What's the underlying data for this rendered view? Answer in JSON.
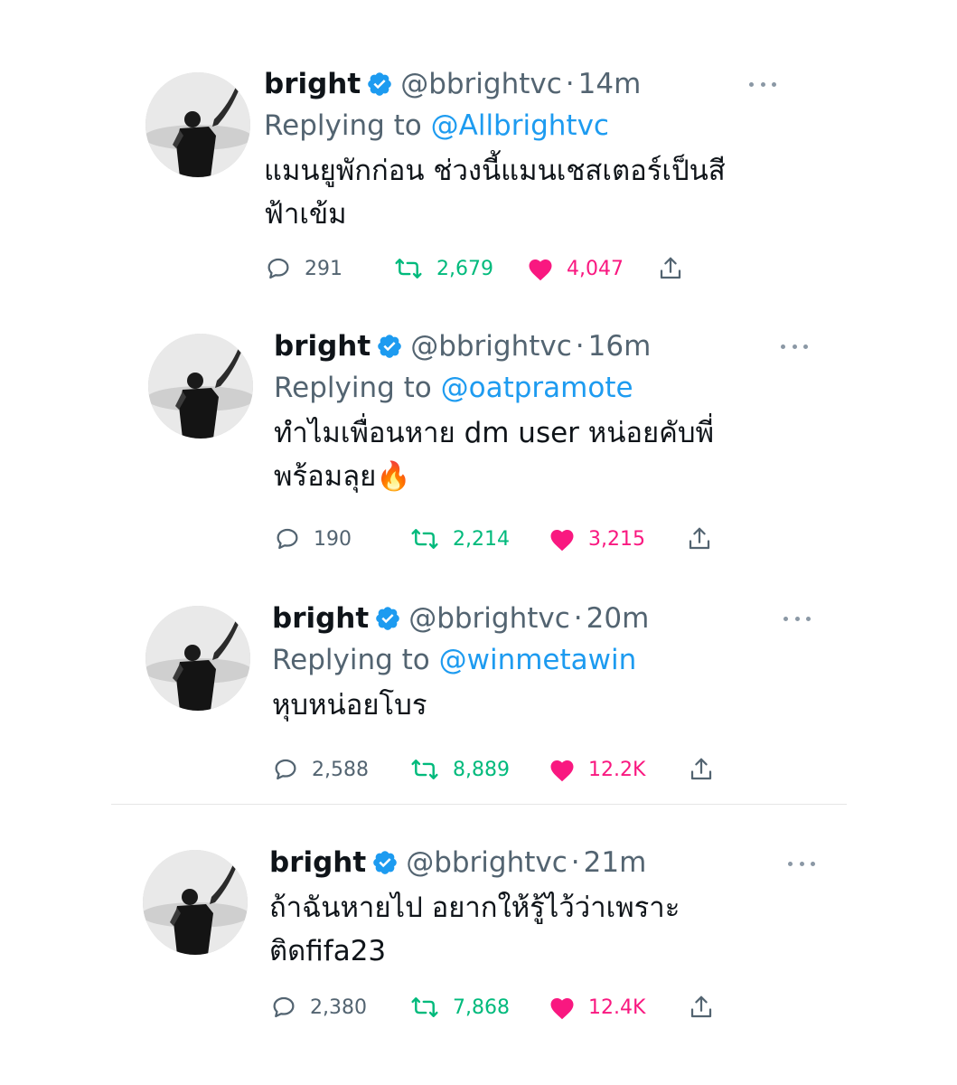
{
  "tweets": [
    {
      "name": "bright",
      "handle": "@bbrightvc",
      "dot": "·",
      "time": "14m",
      "replying_prefix": "Replying to ",
      "replying_to": "@Allbrightvc",
      "text_lines": [
        "แมนยูพักก่อน ช่วงนี้แมนเชสเตอร์เป็นสี",
        "ฟ้าเข้ม"
      ],
      "replies": "291",
      "retweets": "2,679",
      "likes": "4,047"
    },
    {
      "name": "bright",
      "handle": "@bbrightvc",
      "dot": "·",
      "time": "16m",
      "replying_prefix": "Replying to ",
      "replying_to": "@oatpramote",
      "text_lines": [
        "ทำไมเพื่อนหาย dm user หน่อยคับพี่",
        "พร้อมลุย"
      ],
      "emoji": "🔥",
      "replies": "190",
      "retweets": "2,214",
      "likes": "3,215"
    },
    {
      "name": "bright",
      "handle": "@bbrightvc",
      "dot": "·",
      "time": "20m",
      "replying_prefix": "Replying to ",
      "replying_to": "@winmetawin",
      "text_lines": [
        "หุบหน่อยโบร"
      ],
      "replies": "2,588",
      "retweets": "8,889",
      "likes": "12.2K"
    },
    {
      "name": "bright",
      "handle": "@bbrightvc",
      "dot": "·",
      "time": "21m",
      "text_lines": [
        "ถ้าฉันหายไป อยากให้รู้ไว้ว่าเพราะ",
        "ติดfifa23"
      ],
      "replies": "2,380",
      "retweets": "7,868",
      "likes": "12.4K"
    }
  ],
  "colors": {
    "text": "#0f1419",
    "muted": "#536471",
    "mention": "#1d9bf0",
    "verified": "#1d9bf0",
    "retweet": "#00ba7c",
    "like": "#f91880"
  },
  "icons": {
    "avatar": "profile-photo",
    "verified": "verified-badge-icon",
    "more": "more-options-icon",
    "reply": "reply-icon",
    "retweet": "retweet-icon",
    "like": "heart-icon",
    "share": "share-icon"
  }
}
